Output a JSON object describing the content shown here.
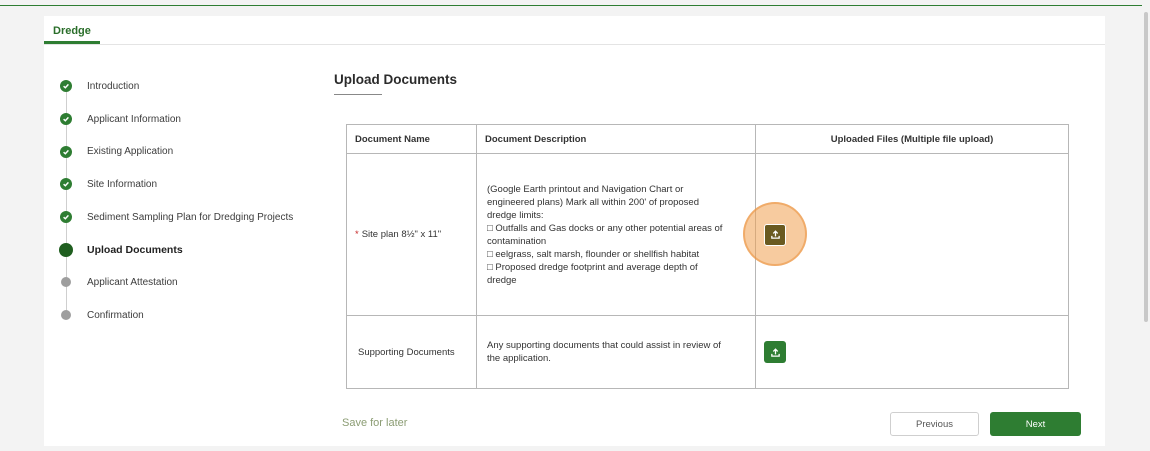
{
  "colors": {
    "accent": "#2e7d32",
    "required": "#c62828",
    "highlight": "#f0a050"
  },
  "tab": {
    "label": "Dredge"
  },
  "steps": [
    {
      "label": "Introduction",
      "status": "complete"
    },
    {
      "label": "Applicant Information",
      "status": "complete"
    },
    {
      "label": "Existing Application",
      "status": "complete"
    },
    {
      "label": "Site Information",
      "status": "complete"
    },
    {
      "label": "Sediment Sampling Plan for Dredging Projects",
      "status": "complete"
    },
    {
      "label": "Upload Documents",
      "status": "current"
    },
    {
      "label": "Applicant Attestation",
      "status": "incomplete"
    },
    {
      "label": "Confirmation",
      "status": "incomplete"
    }
  ],
  "main": {
    "title": "Upload Documents",
    "table": {
      "headers": [
        "Document Name",
        "Document Description",
        "Uploaded Files (Multiple file upload)"
      ],
      "rows": [
        {
          "required_mark": "*",
          "name": "Site plan 8½\" x 11\"",
          "description": [
            "(Google Earth printout and Navigation Chart or",
            "engineered plans) Mark all within 200' of proposed",
            "dredge limits:",
            "□ Outfalls and Gas docks or any other potential areas of",
            "contamination",
            "□ eelgrass, salt marsh, flounder or shellfish habitat",
            "□ Proposed dredge footprint and average depth of",
            "dredge"
          ],
          "upload_icon": "upload-icon"
        },
        {
          "required_mark": "",
          "name": "Supporting Documents",
          "description": [
            "Any supporting documents that could assist in review of",
            "the application."
          ],
          "upload_icon": "upload-icon"
        }
      ]
    }
  },
  "footer": {
    "save_later": "Save for later",
    "previous": "Previous",
    "next": "Next"
  }
}
